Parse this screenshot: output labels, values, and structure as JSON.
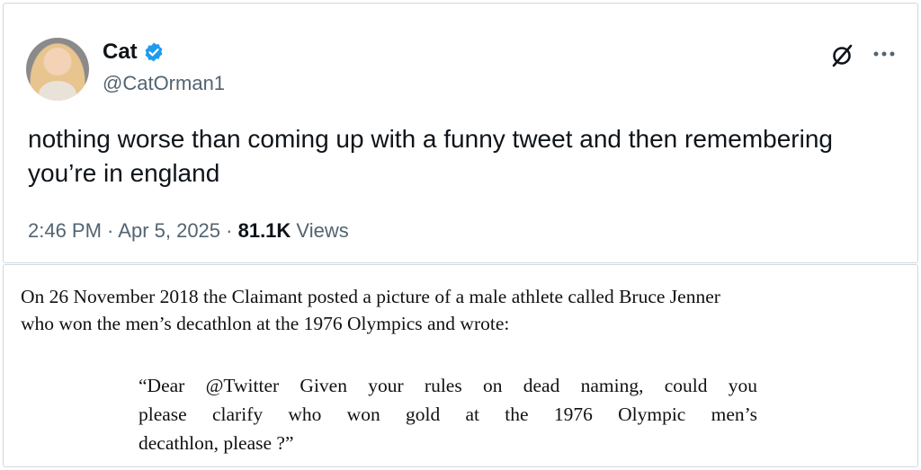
{
  "tweet": {
    "display_name": "Cat",
    "handle": "@CatOrman1",
    "text_line1": "nothing worse than coming up with a funny tweet and then remembering",
    "text_line2": "you’re in england",
    "time": "2:46 PM",
    "sep1": " · ",
    "date": "Apr 5, 2025",
    "sep2": " · ",
    "views_count": "81.1K",
    "views_label": " Views",
    "icons": {
      "verified": "verified-badge-icon",
      "grok": "grok-icon",
      "more": "more-options-icon"
    },
    "colors": {
      "verified": "#1d9bf0",
      "secondary_text": "#536471",
      "text": "#0f1419"
    }
  },
  "excerpt": {
    "paragraph_line1": "On 26 November 2018 the Claimant posted a picture of a male athlete called Bruce Jenner",
    "paragraph_line2": "who won the men’s decathlon at the 1976 Olympics and wrote:",
    "quote_line1": "“Dear @Twitter Given your rules on dead naming, could you",
    "quote_line2": "please clarify who won gold at the 1976 Olympic men’s",
    "quote_line3": "decathlon, please ?”"
  }
}
